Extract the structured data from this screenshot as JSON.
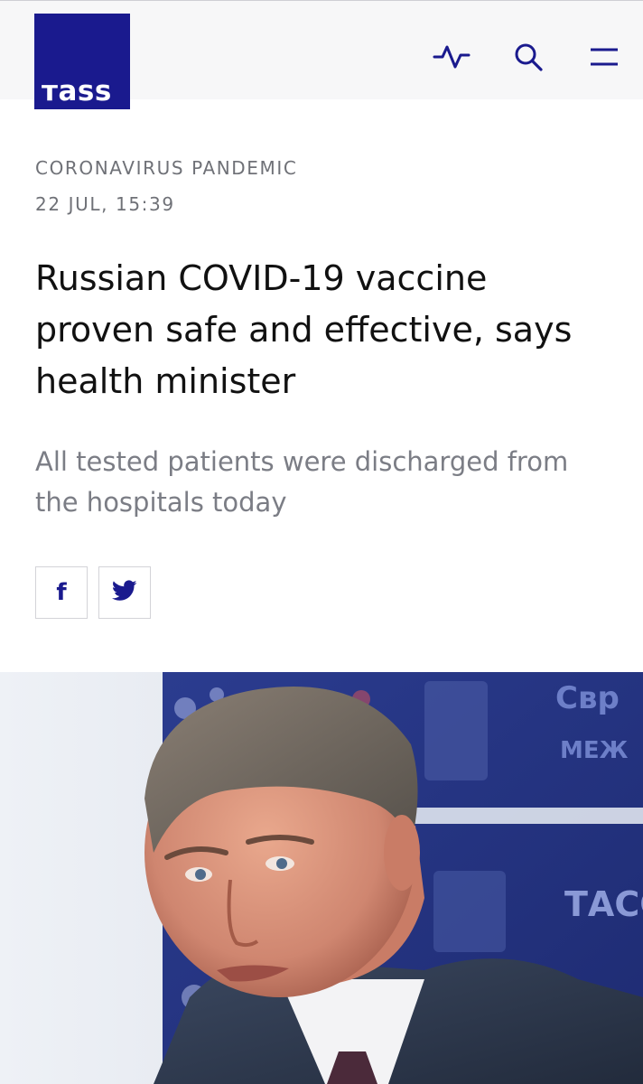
{
  "header": {
    "logo_text": "тass",
    "icons": [
      "pulse-icon",
      "search-icon",
      "menu-icon"
    ],
    "accent_color": "#1a1a8e"
  },
  "article": {
    "rubric": "CORONAVIRUS PANDEMIC",
    "date": "22 JUL, 15:39",
    "headline": "Russian COVID-19 vaccine proven safe and effective, says health minister",
    "lead": "All tested patients were discharged from the hospitals today"
  },
  "share": {
    "facebook_label": "f",
    "twitter_icon": "twitter-bird-icon"
  },
  "photo": {
    "background_text_1": "Cвp",
    "background_text_2": "МЕЖ",
    "background_text_3": "ТАСС"
  }
}
